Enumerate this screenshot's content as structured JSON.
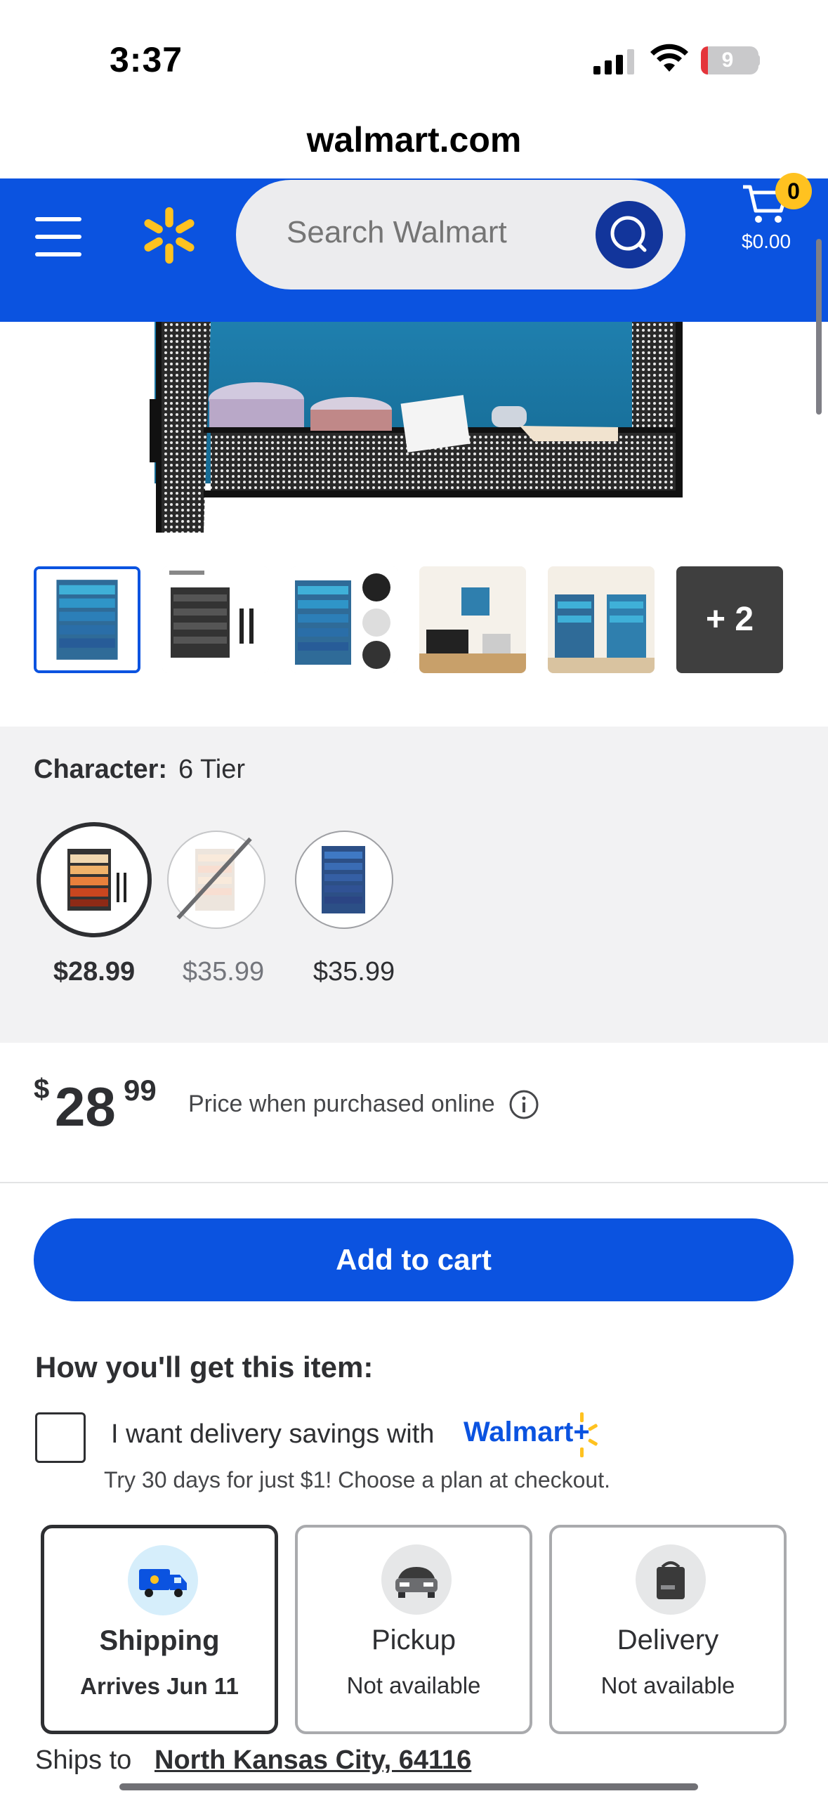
{
  "status_bar": {
    "time": "3:37",
    "battery": "9"
  },
  "browser": {
    "url": "walmart.com"
  },
  "header": {
    "search_placeholder": "Search Walmart",
    "cart_count": "0",
    "cart_total": "$0.00",
    "brand_color": "#0b53e0",
    "accent_color": "#ffc220"
  },
  "gallery": {
    "more_label": "+ 2",
    "thumb_count": 6
  },
  "variants": {
    "label": "Character:",
    "value": "6 Tier",
    "options": [
      {
        "price": "$28.99",
        "selected": true,
        "available": true
      },
      {
        "price": "$35.99",
        "selected": false,
        "available": false
      },
      {
        "price": "$35.99",
        "selected": false,
        "available": true
      }
    ]
  },
  "price": {
    "dollar_sign": "$",
    "whole": "28",
    "cents": "99",
    "note": "Price when purchased online"
  },
  "cart_button": {
    "label": "Add to cart"
  },
  "fulfillment": {
    "title": "How you'll get this item:",
    "savings_text": "I want delivery savings with",
    "walmart_plus": "Walmart+",
    "trial_text": "Try 30 days for just $1! Choose a plan at checkout.",
    "options": [
      {
        "title": "Shipping",
        "sub": "Arrives Jun 11",
        "icon": "shipping-truck-icon",
        "selected": true
      },
      {
        "title": "Pickup",
        "sub": "Not available",
        "icon": "pickup-car-icon",
        "selected": false
      },
      {
        "title": "Delivery",
        "sub": "Not available",
        "icon": "delivery-bag-icon",
        "selected": false
      }
    ],
    "ships_label": "Ships to",
    "ships_location": "North Kansas City, 64116"
  }
}
